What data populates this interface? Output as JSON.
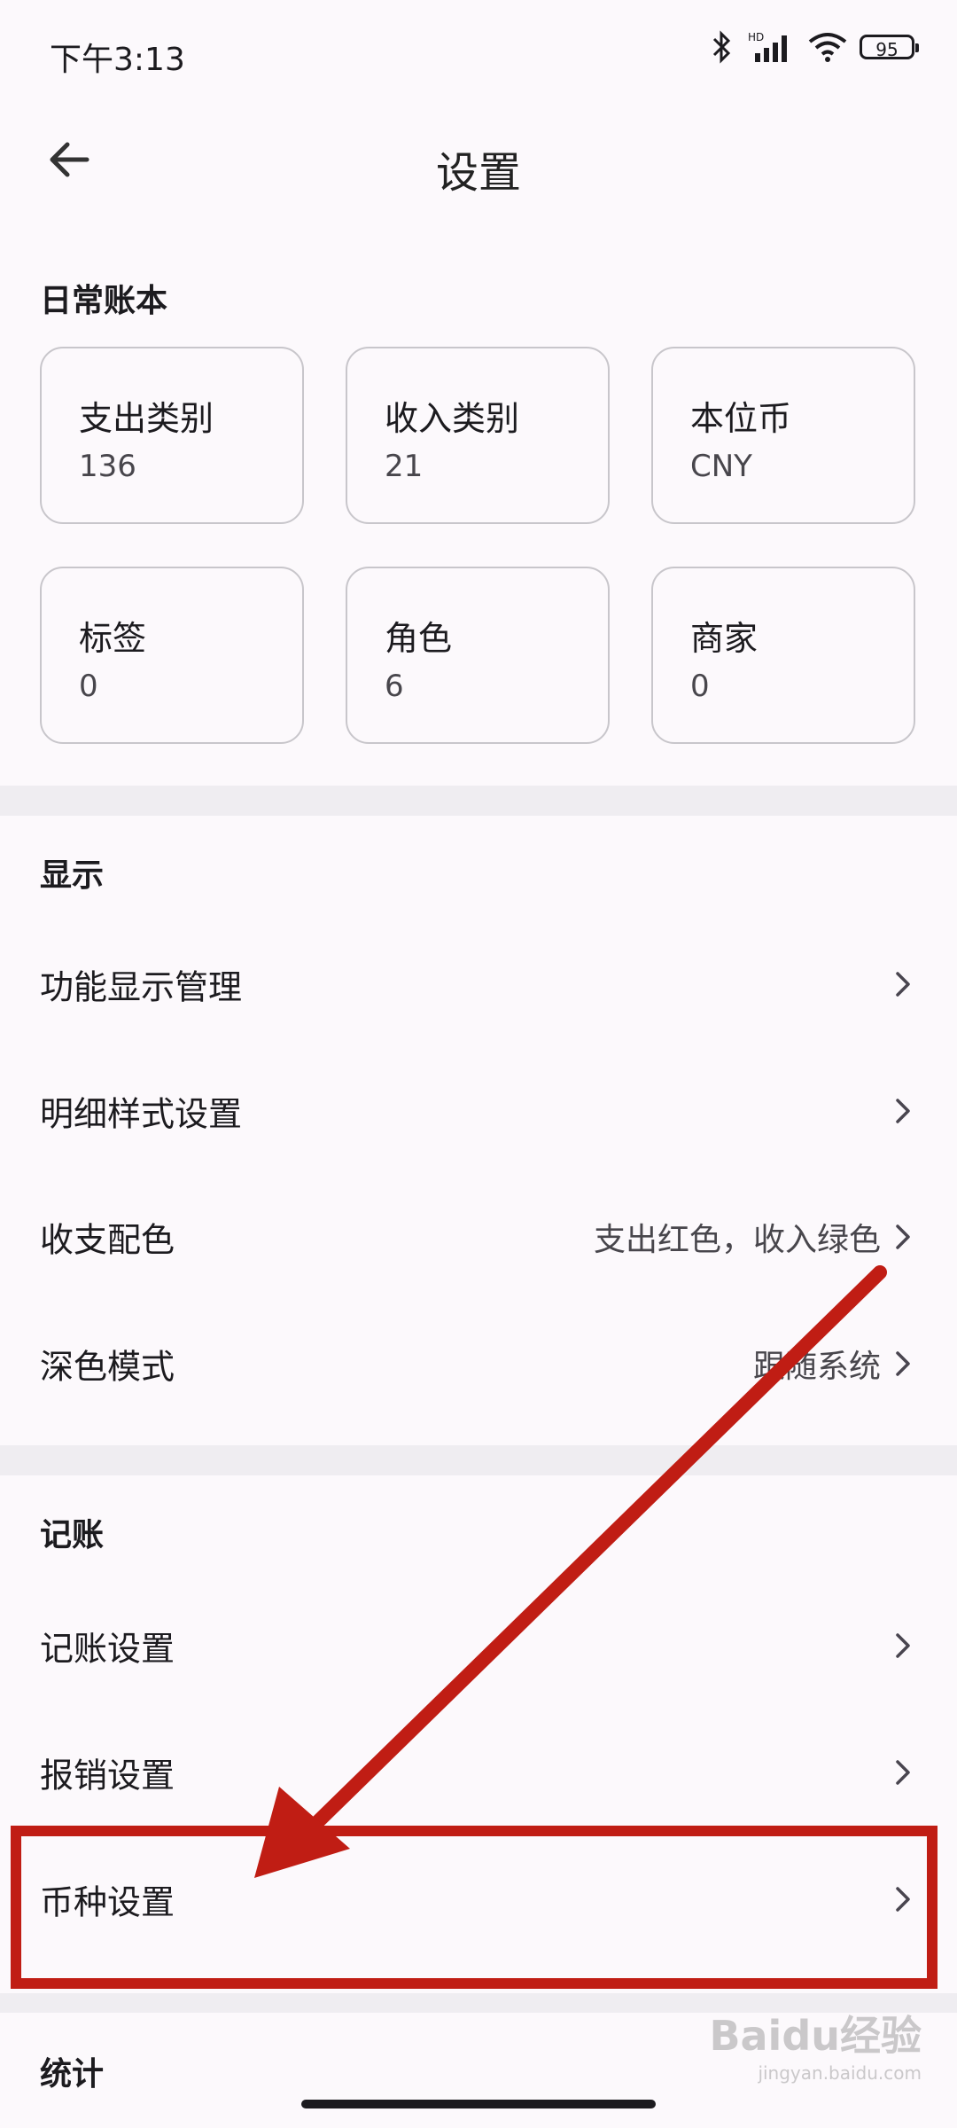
{
  "status": {
    "time": "下午3:13",
    "battery": "95"
  },
  "header": {
    "title": "设置"
  },
  "ledger": {
    "title": "日常账本",
    "cards": [
      {
        "label": "支出类别",
        "value": "136"
      },
      {
        "label": "收入类别",
        "value": "21"
      },
      {
        "label": "本位币",
        "value": "CNY"
      },
      {
        "label": "标签",
        "value": "0"
      },
      {
        "label": "角色",
        "value": "6"
      },
      {
        "label": "商家",
        "value": "0"
      }
    ]
  },
  "display": {
    "title": "显示",
    "items": [
      {
        "label": "功能显示管理",
        "value": ""
      },
      {
        "label": "明细样式设置",
        "value": ""
      },
      {
        "label": "收支配色",
        "value": "支出红色，收入绿色"
      },
      {
        "label": "深色模式",
        "value": "跟随系统"
      }
    ]
  },
  "accounting": {
    "title": "记账",
    "items": [
      {
        "label": "记账设置"
      },
      {
        "label": "报销设置"
      },
      {
        "label": "币种设置"
      }
    ]
  },
  "stats": {
    "title": "统计"
  },
  "watermark": {
    "text": "Baidu经验",
    "sub": "jingyan.baidu.com"
  },
  "annotation": {
    "color": "#c01d14"
  }
}
